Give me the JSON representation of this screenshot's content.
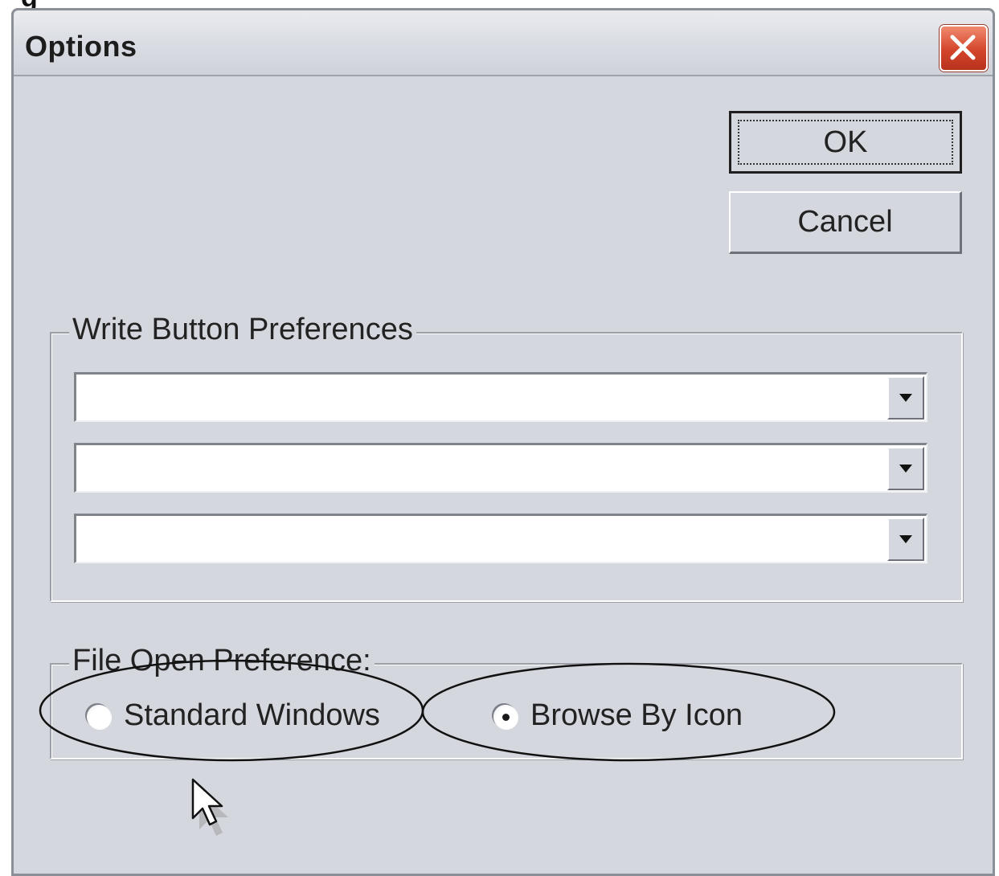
{
  "page_fragment": "g",
  "dialog": {
    "title": "Options",
    "buttons": {
      "ok_label": "OK",
      "cancel_label": "Cancel"
    },
    "write_group": {
      "legend": "Write Button Preferences",
      "combos": [
        {
          "value": ""
        },
        {
          "value": ""
        },
        {
          "value": ""
        }
      ]
    },
    "file_group": {
      "legend": "File Open Preference:",
      "options": [
        {
          "label": "Standard Windows",
          "selected": false
        },
        {
          "label": "Browse By Icon",
          "selected": true
        }
      ]
    }
  },
  "icons": {
    "close": "close-icon",
    "dropdown": "chevron-down-icon",
    "cursor": "mouse-cursor-icon"
  },
  "colors": {
    "dialog_bg": "#d4d7de",
    "close_button": "#d3452b"
  }
}
